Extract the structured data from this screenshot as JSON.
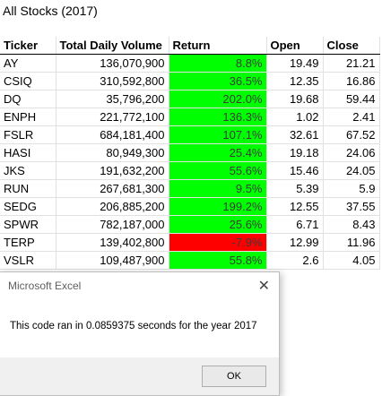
{
  "sheet_title": "All Stocks (2017)",
  "headers": [
    "Ticker",
    "Total Daily Volume",
    "Return",
    "Open",
    "Close"
  ],
  "rows": [
    {
      "ticker": "AY",
      "volume": "136,070,900",
      "ret": "8.8%",
      "open": "19.49",
      "close": "21.21",
      "sign": "pos"
    },
    {
      "ticker": "CSIQ",
      "volume": "310,592,800",
      "ret": "36.5%",
      "open": "12.35",
      "close": "16.86",
      "sign": "pos"
    },
    {
      "ticker": "DQ",
      "volume": "35,796,200",
      "ret": "202.0%",
      "open": "19.68",
      "close": "59.44",
      "sign": "pos"
    },
    {
      "ticker": "ENPH",
      "volume": "221,772,100",
      "ret": "136.3%",
      "open": "1.02",
      "close": "2.41",
      "sign": "pos"
    },
    {
      "ticker": "FSLR",
      "volume": "684,181,400",
      "ret": "107.1%",
      "open": "32.61",
      "close": "67.52",
      "sign": "pos"
    },
    {
      "ticker": "HASI",
      "volume": "80,949,300",
      "ret": "25.4%",
      "open": "19.18",
      "close": "24.06",
      "sign": "pos"
    },
    {
      "ticker": "JKS",
      "volume": "191,632,200",
      "ret": "55.6%",
      "open": "15.46",
      "close": "24.05",
      "sign": "pos"
    },
    {
      "ticker": "RUN",
      "volume": "267,681,300",
      "ret": "9.5%",
      "open": "5.39",
      "close": "5.9",
      "sign": "pos"
    },
    {
      "ticker": "SEDG",
      "volume": "206,885,200",
      "ret": "199.2%",
      "open": "12.55",
      "close": "37.55",
      "sign": "pos"
    },
    {
      "ticker": "SPWR",
      "volume": "782,187,000",
      "ret": "25.6%",
      "open": "6.71",
      "close": "8.43",
      "sign": "pos"
    },
    {
      "ticker": "TERP",
      "volume": "139,402,800",
      "ret": "-7.9%",
      "open": "12.99",
      "close": "11.96",
      "sign": "neg"
    },
    {
      "ticker": "VSLR",
      "volume": "109,487,900",
      "ret": "55.8%",
      "open": "2.6",
      "close": "4.05",
      "sign": "pos"
    }
  ],
  "colors": {
    "positive": "#00ff00",
    "negative": "#ff0000"
  },
  "dialog": {
    "title": "Microsoft Excel",
    "message": "This code ran in 0.0859375 seconds for the year 2017",
    "ok_label": "OK",
    "close_icon": "close-icon"
  }
}
